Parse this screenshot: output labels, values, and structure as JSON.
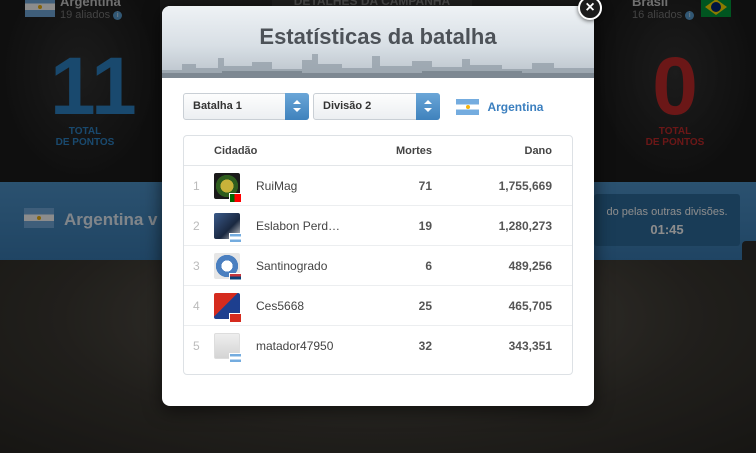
{
  "background": {
    "left_country": {
      "name": "Argentina",
      "allies": "19 aliados"
    },
    "right_country": {
      "name": "Brasil",
      "allies": "16 aliados"
    },
    "campaign_label": "DETALHES DA CAMPANHA",
    "left_score": "11",
    "right_score": "0",
    "score_caption_line1": "TOTAL",
    "score_caption_line2": "DE PONTOS",
    "bar_title": "Argentina v",
    "bar_message": "do pelas outras divisões.",
    "bar_timer": "01:45",
    "side_tab_glyph": "«"
  },
  "modal": {
    "title": "Estatísticas da batalha",
    "close_glyph": "×",
    "battle_select": "Batalha 1",
    "division_select": "Divisão 2",
    "country_filter": "Argentina",
    "columns": {
      "city": "Cidadão",
      "kills": "Mortes",
      "damage": "Dano"
    },
    "rows": [
      {
        "rank": "1",
        "name": "RuiMag",
        "kills": "71",
        "damage": "1,755,669",
        "flag": "pt"
      },
      {
        "rank": "2",
        "name": "Eslabon Perd…",
        "kills": "19",
        "damage": "1,280,273",
        "flag": "ar"
      },
      {
        "rank": "3",
        "name": "Santinogrado",
        "kills": "6",
        "damage": "489,256",
        "flag": "rs"
      },
      {
        "rank": "4",
        "name": "Ces5668",
        "kills": "25",
        "damage": "465,705",
        "flag": "br"
      },
      {
        "rank": "5",
        "name": "matador47950",
        "kills": "32",
        "damage": "343,351",
        "flag": "ar"
      }
    ]
  },
  "colors": {
    "accent_blue": "#3b7fbf",
    "score_blue": "#2f86c8",
    "score_red": "#c42a2a"
  }
}
